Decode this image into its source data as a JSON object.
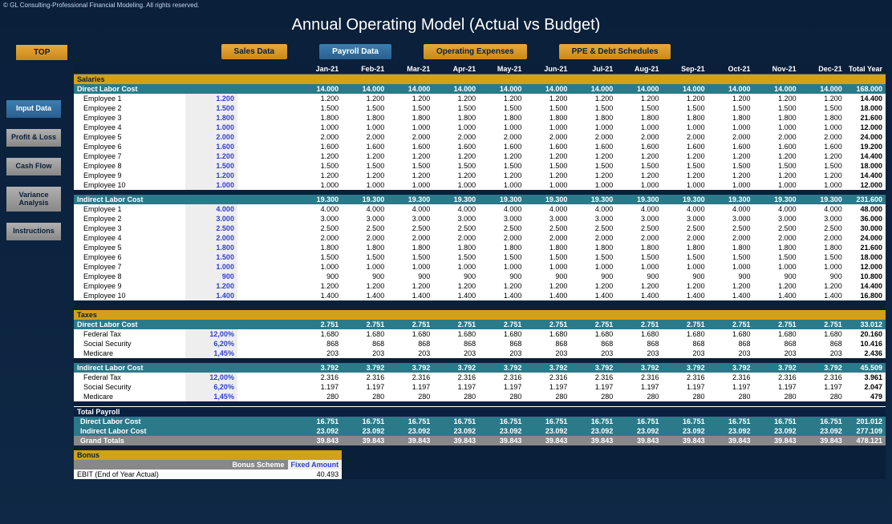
{
  "copyright": "© GL Consulting-Professional Financial Modeling. All rights reserved.",
  "title": "Annual Operating Model (Actual vs Budget)",
  "buttons": {
    "top": "TOP"
  },
  "nav": [
    "Sales Data",
    "Payroll Data",
    "Operating Expenses",
    "PPE & Debt Schedules"
  ],
  "side": [
    "Input Data",
    "Profit & Loss",
    "Cash Flow",
    "Variance Analysis",
    "Instructions"
  ],
  "months": [
    "Jan-21",
    "Feb-21",
    "Mar-21",
    "Apr-21",
    "May-21",
    "Jun-21",
    "Jul-21",
    "Aug-21",
    "Sep-21",
    "Oct-21",
    "Nov-21",
    "Dec-21"
  ],
  "totalLabel": "Total Year",
  "sections": {
    "salaries": {
      "label": "Salaries",
      "direct": {
        "label": "Direct Labor Cost",
        "month": "14.000",
        "year": "168.000",
        "rows": [
          {
            "name": "Employee 1",
            "input": "1.200",
            "m": "1.200",
            "t": "14.400"
          },
          {
            "name": "Employee 2",
            "input": "1.500",
            "m": "1.500",
            "t": "18.000"
          },
          {
            "name": "Employee 3",
            "input": "1.800",
            "m": "1.800",
            "t": "21.600"
          },
          {
            "name": "Employee 4",
            "input": "1.000",
            "m": "1.000",
            "t": "12.000"
          },
          {
            "name": "Employee 5",
            "input": "2.000",
            "m": "2.000",
            "t": "24.000"
          },
          {
            "name": "Employee 6",
            "input": "1.600",
            "m": "1.600",
            "t": "19.200"
          },
          {
            "name": "Employee 7",
            "input": "1.200",
            "m": "1.200",
            "t": "14.400"
          },
          {
            "name": "Employee 8",
            "input": "1.500",
            "m": "1.500",
            "t": "18.000"
          },
          {
            "name": "Employee 9",
            "input": "1.200",
            "m": "1.200",
            "t": "14.400"
          },
          {
            "name": "Employee 10",
            "input": "1.000",
            "m": "1.000",
            "t": "12.000"
          }
        ]
      },
      "indirect": {
        "label": "Indirect Labor Cost",
        "month": "19.300",
        "year": "231.600",
        "rows": [
          {
            "name": "Employee 1",
            "input": "4.000",
            "m": "4.000",
            "t": "48.000"
          },
          {
            "name": "Employee 2",
            "input": "3.000",
            "m": "3.000",
            "t": "36.000"
          },
          {
            "name": "Employee 3",
            "input": "2.500",
            "m": "2.500",
            "t": "30.000"
          },
          {
            "name": "Employee 4",
            "input": "2.000",
            "m": "2.000",
            "t": "24.000"
          },
          {
            "name": "Employee 5",
            "input": "1.800",
            "m": "1.800",
            "t": "21.600"
          },
          {
            "name": "Employee 6",
            "input": "1.500",
            "m": "1.500",
            "t": "18.000"
          },
          {
            "name": "Employee 7",
            "input": "1.000",
            "m": "1.000",
            "t": "12.000"
          },
          {
            "name": "Employee 8",
            "input": "900",
            "m": "900",
            "t": "10.800"
          },
          {
            "name": "Employee 9",
            "input": "1.200",
            "m": "1.200",
            "t": "14.400"
          },
          {
            "name": "Employee 10",
            "input": "1.400",
            "m": "1.400",
            "t": "16.800"
          }
        ]
      }
    },
    "taxes": {
      "label": "Taxes",
      "direct": {
        "label": "Direct Labor Cost",
        "month": "2.751",
        "year": "33.012",
        "rows": [
          {
            "name": "Federal Tax",
            "input": "12,00%",
            "m": "1.680",
            "t": "20.160"
          },
          {
            "name": "Social Security",
            "input": "6,20%",
            "m": "868",
            "t": "10.416"
          },
          {
            "name": "Medicare",
            "input": "1,45%",
            "m": "203",
            "t": "2.436"
          }
        ]
      },
      "indirect": {
        "label": "Indirect Labor Cost",
        "month": "3.792",
        "year": "45.509",
        "rows": [
          {
            "name": "Federal Tax",
            "input": "12,00%",
            "m": "2.316",
            "t": "3.961"
          },
          {
            "name": "Social Security",
            "input": "6,20%",
            "m": "1.197",
            "t": "2.047"
          },
          {
            "name": "Medicare",
            "input": "1,45%",
            "m": "280",
            "t": "479"
          }
        ]
      }
    }
  },
  "totals": {
    "label": "Total Payroll",
    "direct": {
      "label": "Direct Labor Cost",
      "m": "16.751",
      "t": "201.012"
    },
    "indirect": {
      "label": "Indirect Labor Cost",
      "m": "23.092",
      "t": "277.109"
    },
    "grand": {
      "label": "Grand Totals",
      "m": "39.843",
      "t": "478.121"
    }
  },
  "bonus": {
    "label": "Bonus",
    "scheme": "Bonus Scheme",
    "fixed": "Fixed Amount",
    "ebit_label": "EBIT (End of Year Actual)",
    "ebit": "40.493"
  }
}
